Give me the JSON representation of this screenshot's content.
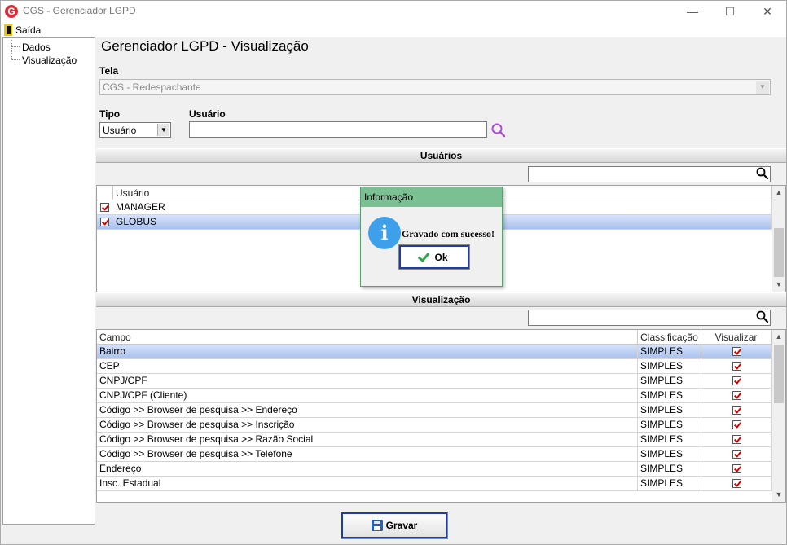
{
  "window": {
    "title": "CGS - Gerenciador LGPD",
    "app_icon_letter": "G",
    "minimize_glyph": "—",
    "maximize_glyph": "☐",
    "close_glyph": "✕"
  },
  "menu": {
    "exit_label": "Saída"
  },
  "tree": {
    "items": [
      "Dados",
      "Visualização"
    ]
  },
  "page": {
    "title": "Gerenciador LGPD - Visualização"
  },
  "form": {
    "tela_label": "Tela",
    "tela_value": "CGS - Redespachante",
    "tipo_label": "Tipo",
    "tipo_value": "Usuário",
    "usuario_label": "Usuário",
    "usuario_value": ""
  },
  "users_section": {
    "header": "Usuários",
    "search_value": "",
    "column": "Usuário",
    "rows": [
      {
        "name": "MANAGER",
        "checked": true,
        "selected": false
      },
      {
        "name": "GLOBUS",
        "checked": true,
        "selected": true
      }
    ]
  },
  "vis_section": {
    "header": "Visualização",
    "search_value": "",
    "columns": [
      "Campo",
      "Classificação",
      "Visualizar"
    ],
    "rows": [
      {
        "campo": "Bairro",
        "classificacao": "SIMPLES",
        "visualizar": true,
        "selected": true
      },
      {
        "campo": "CEP",
        "classificacao": "SIMPLES",
        "visualizar": true
      },
      {
        "campo": "CNPJ/CPF",
        "classificacao": "SIMPLES",
        "visualizar": true
      },
      {
        "campo": "CNPJ/CPF (Cliente)",
        "classificacao": "SIMPLES",
        "visualizar": true
      },
      {
        "campo": "Código >> Browser de pesquisa >> Endereço",
        "classificacao": "SIMPLES",
        "visualizar": true
      },
      {
        "campo": "Código >> Browser de pesquisa >> Inscrição",
        "classificacao": "SIMPLES",
        "visualizar": true
      },
      {
        "campo": "Código >> Browser de pesquisa >> Razão Social",
        "classificacao": "SIMPLES",
        "visualizar": true
      },
      {
        "campo": "Código >> Browser de pesquisa >> Telefone",
        "classificacao": "SIMPLES",
        "visualizar": true
      },
      {
        "campo": "Endereço",
        "classificacao": "SIMPLES",
        "visualizar": true
      },
      {
        "campo": "Insc. Estadual",
        "classificacao": "SIMPLES",
        "visualizar": true
      }
    ]
  },
  "dialog": {
    "title": "Informação",
    "message": "Gravado com sucesso!",
    "ok_label": "Ok",
    "icon_glyph": "i"
  },
  "footer": {
    "save_label": "Gravar"
  },
  "colors": {
    "dialog_title_bg": "#7bc092",
    "selection": "#a9c1ee",
    "checkmark": "#d40000",
    "button_border": "#1c3f9c"
  }
}
